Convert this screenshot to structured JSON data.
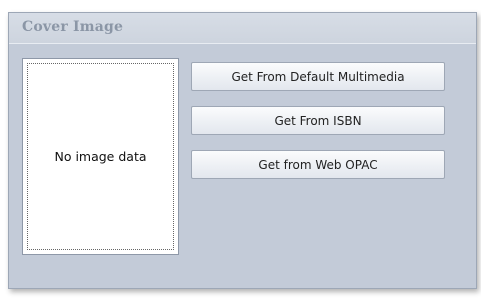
{
  "panel": {
    "title": "Cover Image"
  },
  "image": {
    "placeholder_text": "No image data"
  },
  "buttons": {
    "default_multimedia": "Get From Default Multimedia",
    "isbn": "Get From ISBN",
    "web_opac": "Get from Web OPAC"
  }
}
